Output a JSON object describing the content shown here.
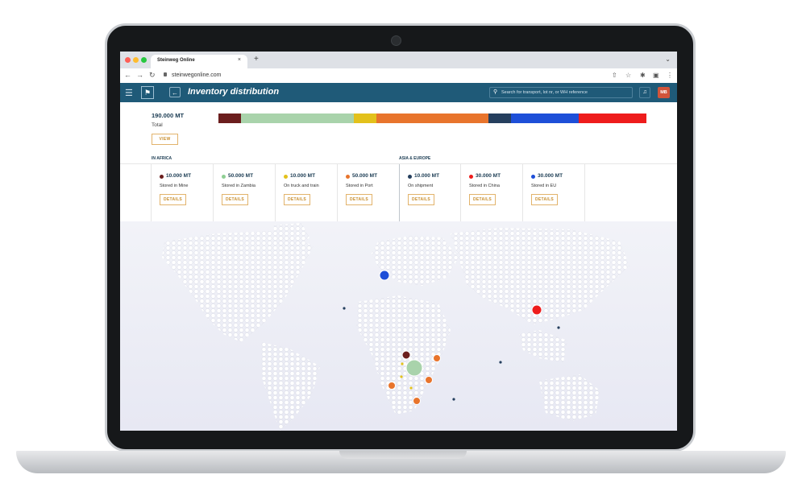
{
  "browser": {
    "tab_title": "Steinweg Online",
    "tab_close": "×",
    "new_tab": "+",
    "url": "steinwegonline.com"
  },
  "header": {
    "menu_icon": "hamburger-icon",
    "logo": "steinweg-logo",
    "back_icon": "arrow-left-icon",
    "title": "Inventory distribution",
    "search_placeholder": "Search for transport, lot nr, or WH reference",
    "bell_icon": "bell-icon",
    "avatar_initials": "MB",
    "avatar_color": "#d1543a",
    "brand_color": "#1f5a78"
  },
  "summary": {
    "total_value": "190.000 MT",
    "total_label": "Total",
    "view_button": "VIEW"
  },
  "sections": {
    "africa": "IN AFRICA",
    "asia_europe": "ASIA & EUROPE"
  },
  "distribution": [
    {
      "color": "#6b1e1e",
      "value_mt": 10000
    },
    {
      "color": "#a9d3ab",
      "value_mt": 50000
    },
    {
      "color": "#e3c11b",
      "value_mt": 10000
    },
    {
      "color": "#e8742c",
      "value_mt": 50000
    },
    {
      "color": "#253f5e",
      "value_mt": 10000
    },
    {
      "color": "#1e4fd8",
      "value_mt": 30000
    },
    {
      "color": "#ee1c1c",
      "value_mt": 30000
    }
  ],
  "cards": [
    {
      "value": "10.000 MT",
      "label": "Stored in Mine",
      "color": "#6b1e1e",
      "button": "DETAILS"
    },
    {
      "value": "50.000 MT",
      "label": "Stored in Zambia",
      "color": "#8fcf94",
      "button": "DETAILS"
    },
    {
      "value": "10.000 MT",
      "label": "On truck and train",
      "color": "#e3c11b",
      "button": "DETAILS"
    },
    {
      "value": "50.000 MT",
      "label": "Stored in Port",
      "color": "#e8742c",
      "button": "DETAILS"
    },
    {
      "value": "10.000 MT",
      "label": "On shipment",
      "color": "#253f5e",
      "button": "DETAILS"
    },
    {
      "value": "30.000 MT",
      "label": "Stored in China",
      "color": "#ee1c1c",
      "button": "DETAILS"
    },
    {
      "value": "30.000 MT",
      "label": "Stored in EU",
      "color": "#1e4fd8",
      "button": "DETAILS"
    }
  ]
}
